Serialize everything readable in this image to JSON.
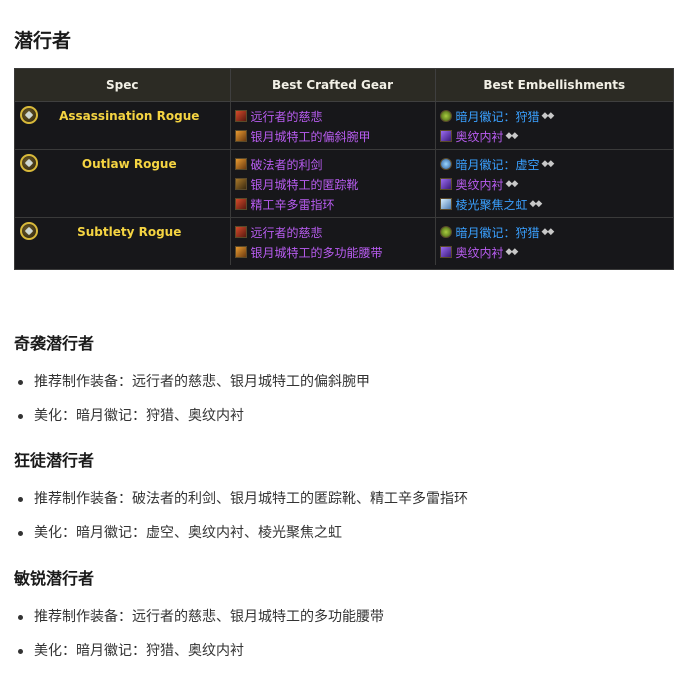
{
  "title": "潜行者",
  "table": {
    "headers": [
      "Spec",
      "Best Crafted Gear",
      "Best Embellishments"
    ],
    "rows": [
      {
        "spec": "Assassination Rogue",
        "gear": [
          {
            "label": "远行者的慈悲",
            "icon": "red"
          },
          {
            "label": "银月城特工的偏斜腕甲",
            "icon": "orange"
          }
        ],
        "embellishments": [
          {
            "label": "暗月徽记：狩猎",
            "icon": "green",
            "color": "blue",
            "diamonds": "◆◆"
          },
          {
            "label": "奥纹内衬",
            "icon": "purple",
            "color": "purple",
            "diamonds": "◆◆"
          }
        ]
      },
      {
        "spec": "Outlaw Rogue",
        "gear": [
          {
            "label": "破法者的利剑",
            "icon": "orange"
          },
          {
            "label": "银月城特工的匿踪靴",
            "icon": "brown"
          },
          {
            "label": "精工辛多雷指环",
            "icon": "red"
          }
        ],
        "embellishments": [
          {
            "label": "暗月徽记：虚空",
            "icon": "blue",
            "color": "blue",
            "diamonds": "◆◆"
          },
          {
            "label": "奥纹内衬",
            "icon": "purple",
            "color": "purple",
            "diamonds": "◆◆"
          },
          {
            "label": "棱光聚焦之虹",
            "icon": "cyan",
            "color": "blue",
            "diamonds": "◆◆"
          }
        ]
      },
      {
        "spec": "Subtlety Rogue",
        "gear": [
          {
            "label": "远行者的慈悲",
            "icon": "red"
          },
          {
            "label": "银月城特工的多功能腰带",
            "icon": "orange"
          }
        ],
        "embellishments": [
          {
            "label": "暗月徽记：狩猎",
            "icon": "green",
            "color": "blue",
            "diamonds": "◆◆"
          },
          {
            "label": "奥纹内衬",
            "icon": "purple",
            "color": "purple",
            "diamonds": "◆◆"
          }
        ]
      }
    ]
  },
  "sections": [
    {
      "heading": "奇袭潜行者",
      "bullets": [
        "推荐制作装备：远行者的慈悲、银月城特工的偏斜腕甲",
        "美化：暗月徽记：狩猎、奥纹内衬"
      ]
    },
    {
      "heading": "狂徒潜行者",
      "bullets": [
        "推荐制作装备：破法者的利剑、银月城特工的匿踪靴、精工辛多雷指环",
        "美化：暗月徽记：虚空、奥纹内衬、棱光聚焦之虹"
      ]
    },
    {
      "heading": "敏锐潜行者",
      "bullets": [
        "推荐制作装备：远行者的慈悲、银月城特工的多功能腰带",
        "美化：暗月徽记：狩猎、奥纹内衬"
      ]
    }
  ],
  "colors": {
    "spec_gold": "#f5d442",
    "purple_item": "#b85cf0",
    "blue_item": "#3aa0ff",
    "table_bg": "#17171a"
  }
}
